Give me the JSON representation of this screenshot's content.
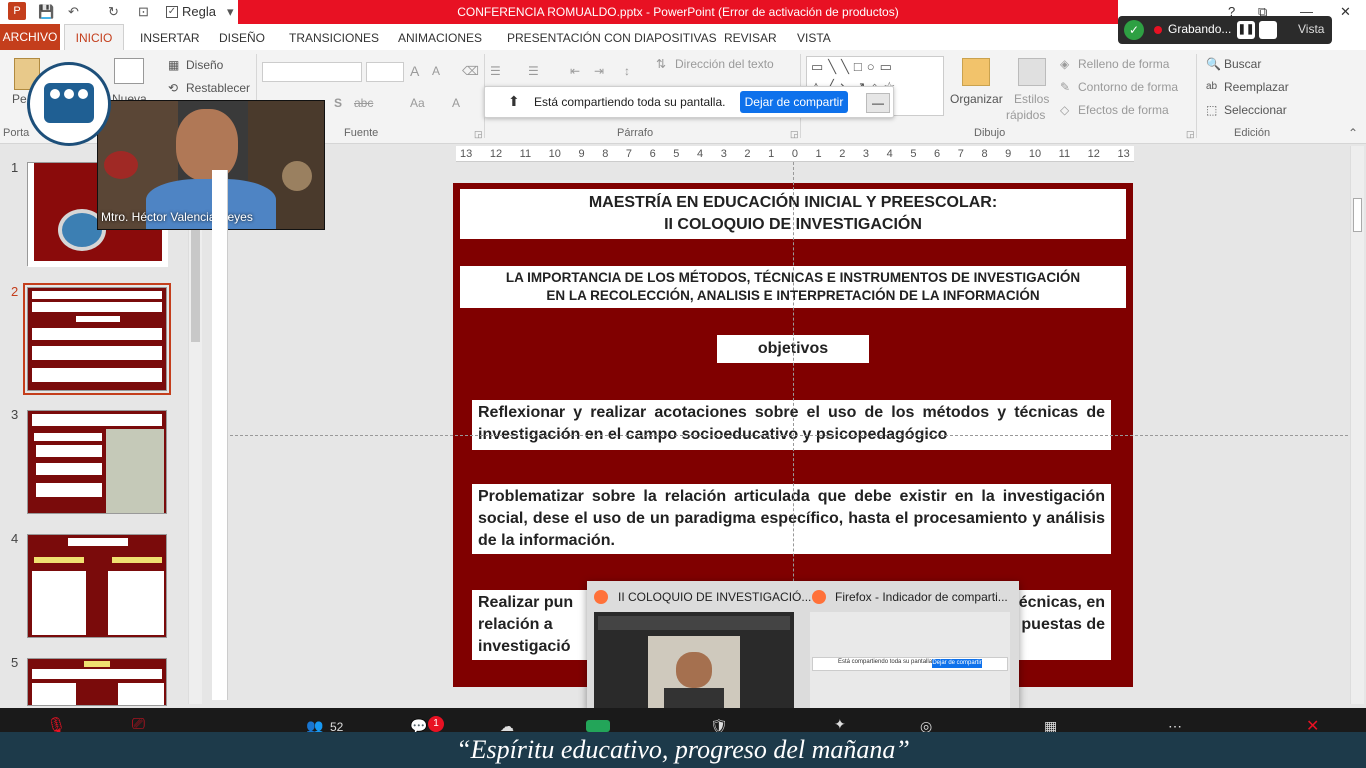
{
  "window": {
    "title": "CONFERENCIA ROMUALDO.pptx  -  PowerPoint (Error de activación de productos)",
    "regla_label": "Regla",
    "recording_label": "Grabando...",
    "vista_label": "Vista"
  },
  "tabs": [
    "ARCHIVO",
    "INICIO",
    "INSERTAR",
    "DISEÑO",
    "TRANSICIONES",
    "ANIMACIONES",
    "PRESENTACIÓN CON DIAPOSITIVAS",
    "REVISAR",
    "VISTA"
  ],
  "ribbon": {
    "portapapeles": "Porta",
    "pegar": "Pe",
    "nueva": "Nueva",
    "diseno": "Diseño",
    "restablecer": "Restablecer",
    "fuente": "Fuente",
    "parrafo": "Párrafo",
    "direccion_texto": "Dirección del texto",
    "dibujo": "Dibujo",
    "organizar": "Organizar",
    "estilos_rapidos_1": "Estilos",
    "estilos_rapidos_2": "rápidos",
    "relleno": "Relleno de forma",
    "contorno": "Contorno de forma",
    "efectos": "Efectos de forma",
    "buscar": "Buscar",
    "reemplazar": "Reemplazar",
    "seleccionar": "Seleccionar",
    "edicion": "Edición"
  },
  "share": {
    "message": "Está compartiendo toda su pantalla.",
    "stop_label": "Dejar de compartir"
  },
  "webcam": {
    "name": "Mtro. Héctor Valencia Reyes"
  },
  "thumbnails": [
    "1",
    "2",
    "3",
    "4",
    "5"
  ],
  "ruler": [
    "13",
    "12",
    "11",
    "10",
    "9",
    "8",
    "7",
    "6",
    "5",
    "4",
    "3",
    "2",
    "1",
    "0",
    "1",
    "2",
    "3",
    "4",
    "5",
    "6",
    "7",
    "8",
    "9",
    "10",
    "11",
    "12",
    "13"
  ],
  "slide": {
    "title_line1": "MAESTRÍA EN EDUCACIÓN INICIAL Y PREESCOLAR:",
    "title_line2": "II COLOQUIO DE INVESTIGACIÓN",
    "subtitle_line1": "LA IMPORTANCIA DE LOS MÉTODOS, TÉCNICAS E INSTRUMENTOS DE INVESTIGACIÓN",
    "subtitle_line2": "EN LA RECOLECCIÓN, ANALISIS E INTERPRETACIÓN DE LA INFORMACIÓN",
    "objectives_label": "objetivos",
    "objective_1": "Reflexionar y realizar acotaciones sobre el uso de los métodos y técnicas de investigación en el campo socioeducativo y psicopedagógico",
    "objective_2": "Problematizar sobre la relación articulada que debe existir en la investigación social, dese el uso de un paradigma específico, hasta el procesamiento y análisis de la información.",
    "objective_3_a": "Realizar pun",
    "objective_3_b": "relación a",
    "objective_3_c": "investigació",
    "objective_3_right_a": "técnicas, en",
    "objective_3_right_b": "puestas de"
  },
  "firefox": {
    "window1": "II COLOQUIO DE INVESTIGACIÓ...",
    "window2": "Firefox - Indicador de comparti...",
    "mini_message": "Está compartiendo toda su pantalla.",
    "mini_stop": "Dejar de compartir"
  },
  "meeting": {
    "participants": "52",
    "chat_badge": "1"
  },
  "motto": "“Espíritu educativo, progreso del mañana”",
  "colors": {
    "accent": "#c43e1c",
    "slide_bg": "#800000",
    "zoom_blue": "#0e71eb",
    "titlebar_red": "#e81123"
  }
}
